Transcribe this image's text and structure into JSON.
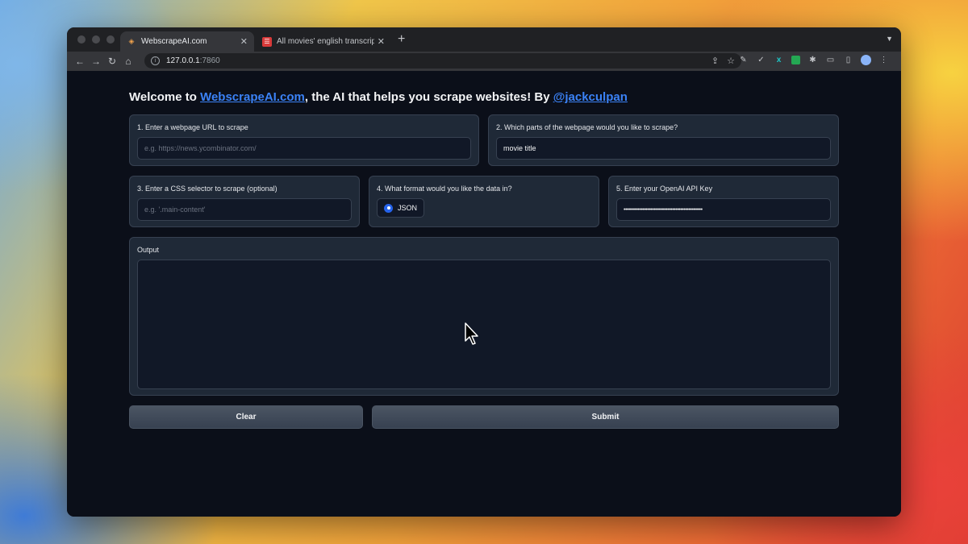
{
  "browser": {
    "tabs": [
      {
        "title": "WebscrapeAI.com",
        "active": true
      },
      {
        "title": "All movies' english transcripts",
        "active": false
      }
    ],
    "new_tab": "+",
    "url_host": "127.0.0.1",
    "url_port": ":7860"
  },
  "page": {
    "heading_prefix": "Welcome to ",
    "heading_link": "WebscrapeAI.com",
    "heading_middle": ", the AI that helps you scrape websites! By ",
    "heading_author": "@jackculpan",
    "url_block": {
      "label": "1. Enter a webpage URL to scrape",
      "placeholder": "e.g. https://news.ycombinator.com/"
    },
    "parts_block": {
      "label": "2. Which parts of the webpage would you like to scrape?",
      "value": "movie title"
    },
    "css_block": {
      "label": "3. Enter a CSS selector to scrape (optional)",
      "placeholder": "e.g. '.main-content'"
    },
    "format_block": {
      "label": "4. What format would you like the data in?",
      "option": "JSON"
    },
    "key_block": {
      "label": "5. Enter your OpenAI API Key",
      "value": "••••••••••••••••••••••••••••••••••••••••••••••••••"
    },
    "output_block": {
      "label": "Output"
    },
    "clear_label": "Clear",
    "submit_label": "Submit"
  },
  "colors": {
    "link": "#3b82f6",
    "radio": "#2563eb",
    "background": "#0b0f19"
  }
}
